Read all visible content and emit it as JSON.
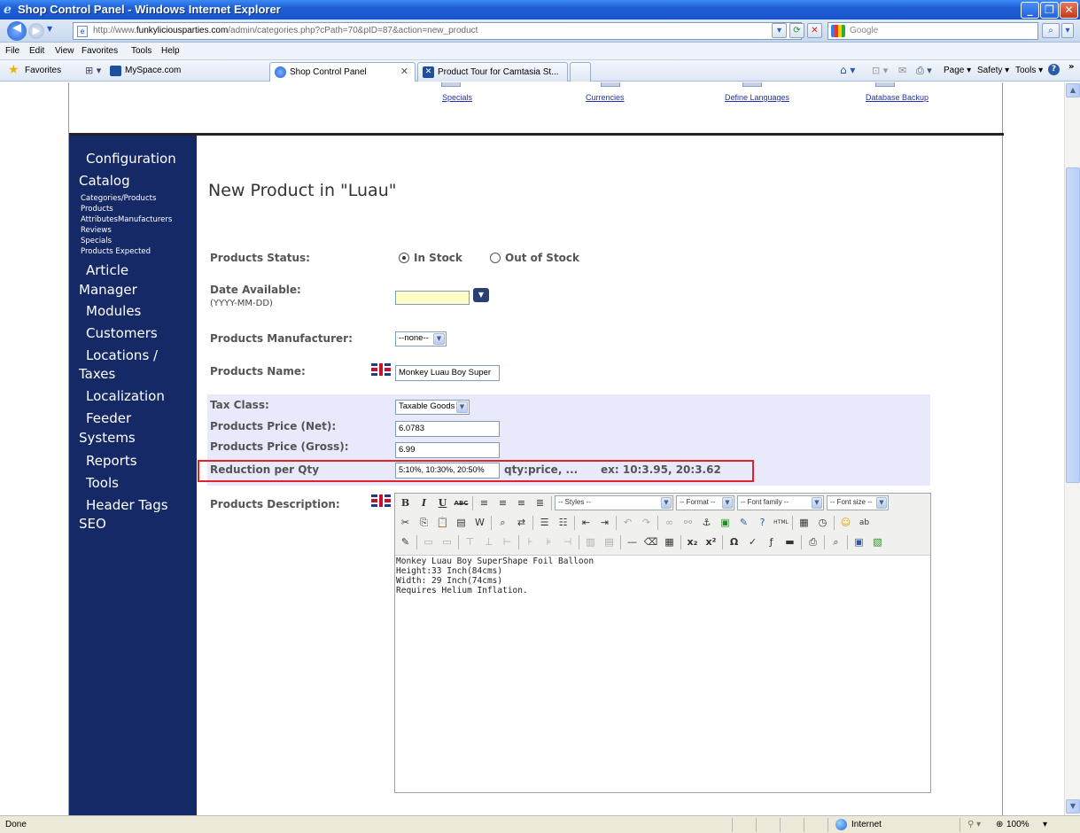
{
  "window": {
    "title": "Shop Control Panel - Windows Internet Explorer",
    "minimize": "_",
    "maximize": "❐",
    "close": "✕"
  },
  "address_bar": {
    "url_prefix": "http://www.",
    "url_domain": "funkyliciousparties.com",
    "url_path": "/admin/categories.php?cPath=70&pID=87&action=new_product",
    "search_placeholder": "Google"
  },
  "menu": [
    "File",
    "Edit",
    "View",
    "Favorites",
    "Tools",
    "Help"
  ],
  "favorites_bar": {
    "favorites_label": "Favorites",
    "myspace_label": "MySpace.com",
    "tabs": [
      {
        "label": "Shop Control Panel",
        "active": true
      },
      {
        "label": "Product Tour for Camtasia St...",
        "active": false
      }
    ],
    "command_items": [
      "Page ▾",
      "Safety ▾",
      "Tools ▾"
    ]
  },
  "top_links": [
    "Specials",
    "Currencies",
    "Define Languages",
    "Database Backup"
  ],
  "sidebar": {
    "headings": [
      "Configuration",
      "Catalog"
    ],
    "catalog_items": [
      "Categories/Products",
      "Products",
      "AttributesManufacturers",
      "Reviews",
      "Specials",
      "Products Expected"
    ],
    "more": [
      "Article",
      "Manager",
      "Modules",
      "Customers",
      "Locations /",
      "Taxes",
      "Localization",
      "Feeder",
      "Systems",
      "Reports",
      "Tools",
      "Header Tags",
      "SEO"
    ]
  },
  "page": {
    "title": "New Product in \"Luau\"",
    "status_label": "Products Status:",
    "status_options": [
      "In Stock",
      "Out of Stock"
    ],
    "status_selected": "In Stock",
    "date_label": "Date Available:",
    "date_format": "(YYYY-MM-DD)",
    "date_value": "",
    "manufacturer_label": "Products Manufacturer:",
    "manufacturer_value": "--none--",
    "name_label": "Products Name:",
    "name_value": "Monkey Luau Boy Super",
    "tax_label": "Tax Class:",
    "tax_value": "Taxable Goods",
    "price_net_label": "Products Price (Net):",
    "price_net_value": "6.0783",
    "price_gross_label": "Products Price (Gross):",
    "price_gross_value": "6.99",
    "reduction_label": "Reduction per Qty",
    "reduction_value": "5:10%, 10:30%, 20:50%",
    "reduction_hint": "qty:price, ...",
    "reduction_example": "ex: 10:3.95, 20:3.62",
    "description_label": "Products Description:",
    "editor_selects": [
      "-- Styles --",
      "-- Format --",
      "-- Font family --",
      "-- Font size --"
    ],
    "description_lines": [
      "Monkey Luau Boy SuperShape Foil Balloon",
      "Height:33 Inch(84cms)",
      "",
      "Width: 29 Inch(74cms)",
      "",
      "Requires Helium Inflation."
    ]
  },
  "status_bar": {
    "left": "Done",
    "zone": "Internet",
    "zoom": "100%"
  }
}
